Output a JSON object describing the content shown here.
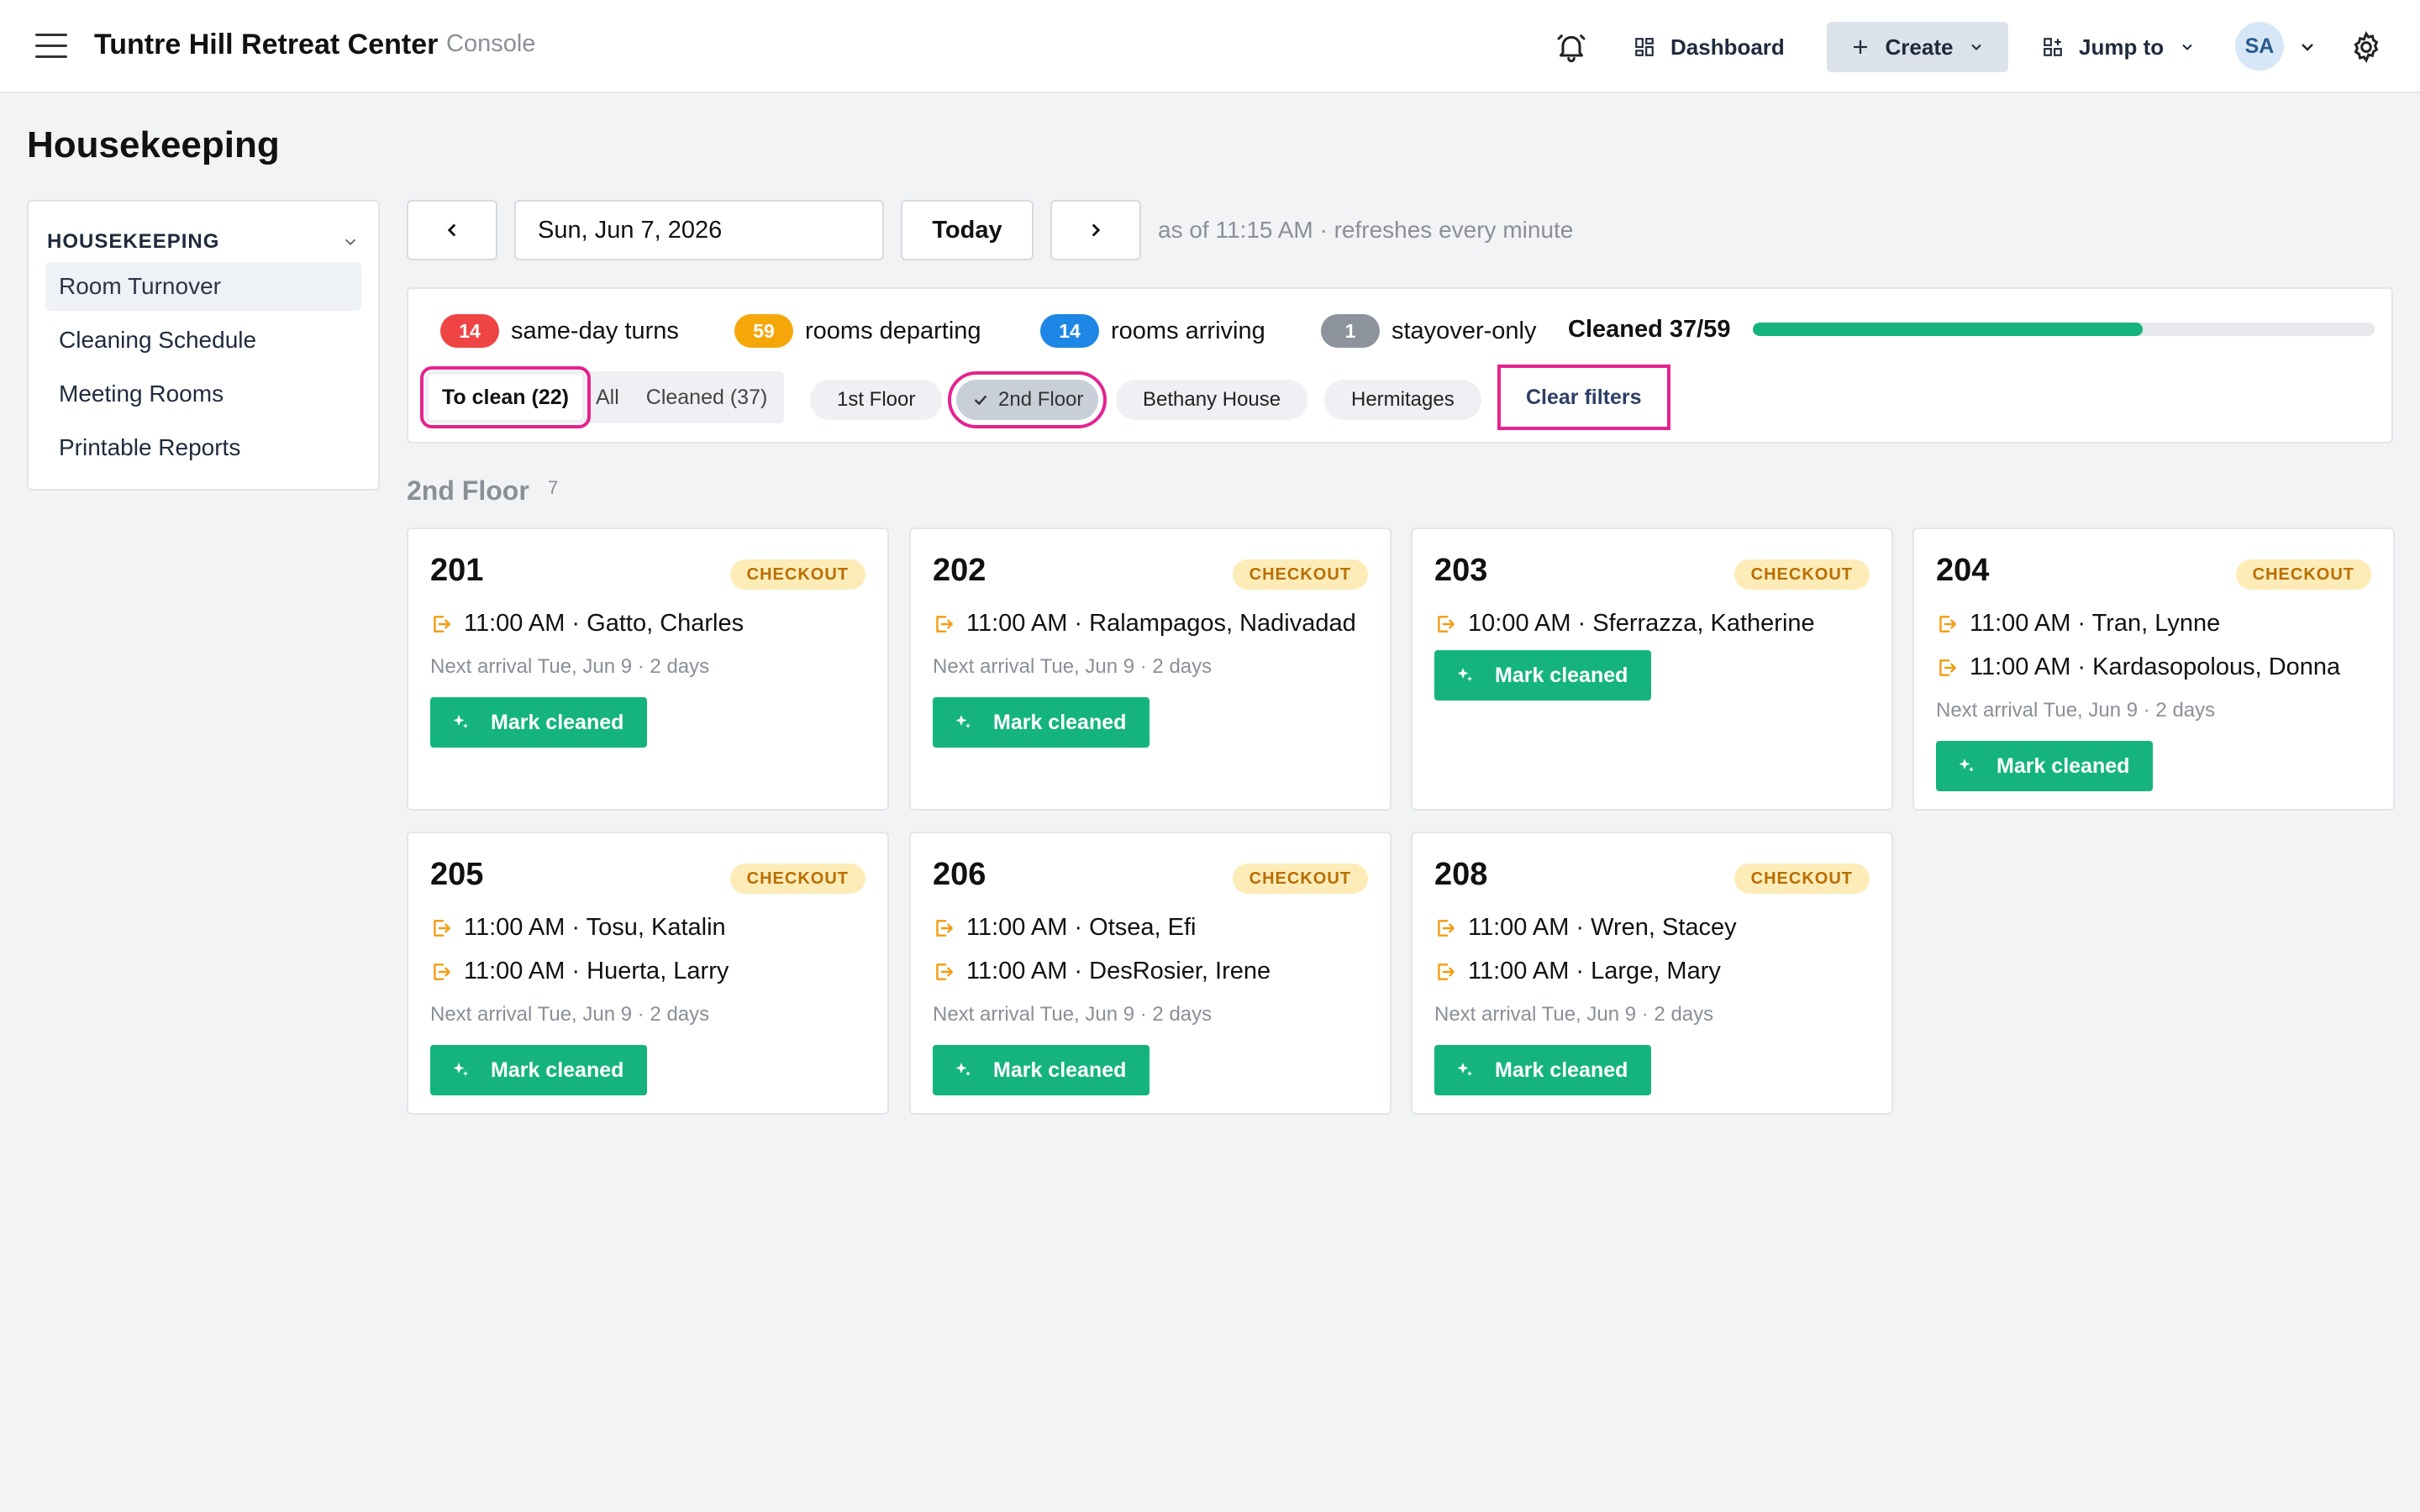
{
  "app": {
    "title": "Tuntre Hill Retreat Center",
    "subtitle": "Console"
  },
  "topnav": {
    "dashboard": "Dashboard",
    "create": "Create",
    "jump_to": "Jump to",
    "avatar_initials": "SA"
  },
  "page": {
    "title": "Housekeeping"
  },
  "sidebar": {
    "heading": "HOUSEKEEPING",
    "items": [
      {
        "label": "Room Turnover",
        "active": true
      },
      {
        "label": "Cleaning Schedule"
      },
      {
        "label": "Meeting Rooms"
      },
      {
        "label": "Printable Reports"
      }
    ]
  },
  "datebar": {
    "date": "Sun, Jun 7, 2026",
    "today": "Today",
    "status": "as of 11:15 AM · refreshes every minute"
  },
  "summary": {
    "stats": [
      {
        "count": "14",
        "label": "same-day turns",
        "color": "#ef4444"
      },
      {
        "count": "59",
        "label": "rooms departing",
        "color": "#f5a70a"
      },
      {
        "count": "14",
        "label": "rooms arriving",
        "color": "#1e86e5"
      },
      {
        "count": "1",
        "label": "stayover-only",
        "color": "#8c939c"
      }
    ],
    "cleaned_label": "Cleaned 37/59",
    "cleaned_fraction": 0.627
  },
  "filters": {
    "status_tabs": [
      {
        "label": "To clean (22)",
        "active": true
      },
      {
        "label": "All"
      },
      {
        "label": "Cleaned (37)"
      }
    ],
    "chips": [
      {
        "label": "1st Floor"
      },
      {
        "label": "2nd Floor",
        "selected": true
      },
      {
        "label": "Bethany House"
      },
      {
        "label": "Hermitages"
      }
    ],
    "clear": "Clear filters"
  },
  "group": {
    "title": "2nd Floor",
    "count": "7"
  },
  "badge_label": "CHECKOUT",
  "mark_label": "Mark cleaned",
  "rooms": [
    {
      "number": "201",
      "guests": [
        "11:00 AM · Gatto, Charles"
      ],
      "next": "Next arrival Tue, Jun 9 · 2 days"
    },
    {
      "number": "202",
      "guests": [
        "11:00 AM · Ralampagos, Nadivadad"
      ],
      "next": "Next arrival Tue, Jun 9 · 2 days"
    },
    {
      "number": "203",
      "guests": [
        "10:00 AM · Sferrazza, Katherine"
      ],
      "next": ""
    },
    {
      "number": "204",
      "guests": [
        "11:00 AM · Tran, Lynne",
        "11:00 AM · Kardasopolous, Donna"
      ],
      "next": "Next arrival Tue, Jun 9 · 2 days"
    },
    {
      "number": "205",
      "guests": [
        "11:00 AM · Tosu, Katalin",
        "11:00 AM · Huerta, Larry"
      ],
      "next": "Next arrival Tue, Jun 9 · 2 days"
    },
    {
      "number": "206",
      "guests": [
        "11:00 AM · Otsea, Efi",
        "11:00 AM · DesRosier, Irene"
      ],
      "next": "Next arrival Tue, Jun 9 · 2 days"
    },
    {
      "number": "208",
      "guests": [
        "11:00 AM · Wren, Stacey",
        "11:00 AM · Large, Mary"
      ],
      "next": "Next arrival Tue, Jun 9 · 2 days"
    }
  ]
}
